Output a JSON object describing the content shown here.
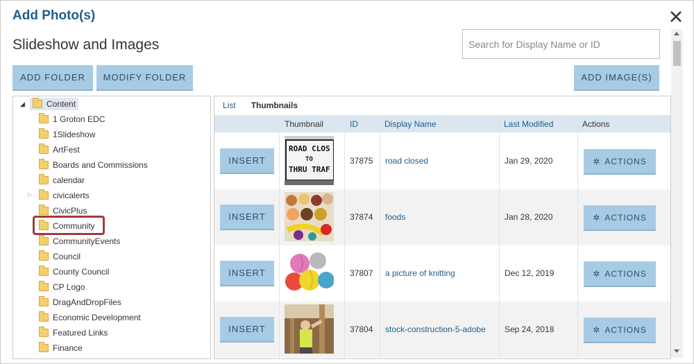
{
  "dialog": {
    "title": "Add Photo(s)",
    "subtitle": "Slideshow and Images",
    "search_placeholder": "Search for Display Name or ID",
    "buttons": {
      "add_folder": "ADD FOLDER",
      "modify_folder": "MODIFY FOLDER",
      "add_images": "ADD IMAGE(S)"
    }
  },
  "tree": {
    "root": "Content",
    "items": [
      {
        "label": "1 Groton EDC"
      },
      {
        "label": "1Slideshow"
      },
      {
        "label": "ArtFest"
      },
      {
        "label": "Boards and Commissions"
      },
      {
        "label": "calendar"
      },
      {
        "label": "civicalerts"
      },
      {
        "label": "CivicPlus"
      },
      {
        "label": "Community"
      },
      {
        "label": "CommunityEvents"
      },
      {
        "label": "Council"
      },
      {
        "label": "County Council"
      },
      {
        "label": "CP Logo"
      },
      {
        "label": "DragAndDropFiles"
      },
      {
        "label": "Economic Development"
      },
      {
        "label": "Featured Links"
      },
      {
        "label": "Finance"
      }
    ]
  },
  "view_tabs": {
    "list": "List",
    "thumbnails": "Thumbnails"
  },
  "table": {
    "headers": {
      "thumbnail": "Thumbnail",
      "id": "ID",
      "display_name": "Display Name",
      "last_modified": "Last Modified",
      "actions": "Actions"
    },
    "insert_label": "INSERT",
    "actions_label": "ACTIONS",
    "rows": [
      {
        "id": "37875",
        "name": "road closed",
        "date": "Jan 29, 2020",
        "thumb_text_1": "ROAD CLOS",
        "thumb_text_2": "TO",
        "thumb_text_3": "THRU TRAF"
      },
      {
        "id": "37874",
        "name": "foods",
        "date": "Jan 28, 2020"
      },
      {
        "id": "37807",
        "name": "a picture of knitting",
        "date": "Dec 12, 2019"
      },
      {
        "id": "37804",
        "name": "stock-construction-5-adobe",
        "date": "Sep 24, 2018"
      }
    ]
  },
  "colors": {
    "title": "#1f5d8c",
    "button_bg": "#a8cbe5",
    "header_bg": "#dbe6f1",
    "highlight": "#a33a3a"
  }
}
